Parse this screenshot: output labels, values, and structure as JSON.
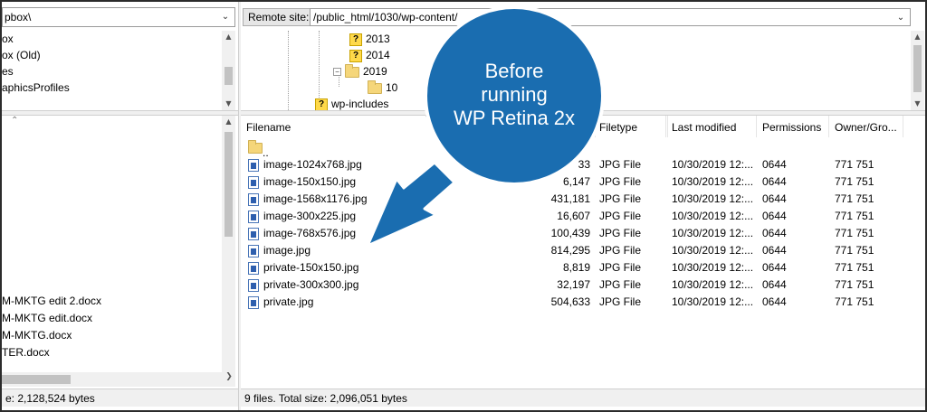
{
  "local": {
    "path": "pbox\\",
    "tree": [
      "ox",
      "ox (Old)",
      "es",
      "aphicsProfiles"
    ],
    "files": [
      "M-MKTG edit 2.docx",
      "M-MKTG edit.docx",
      "M-MKTG.docx",
      "TER.docx"
    ],
    "status": "e: 2,128,524 bytes"
  },
  "remote": {
    "label": "Remote site:",
    "path": "/public_html/1030/wp-content/",
    "tree": [
      {
        "label": "2013",
        "icon": "question-folder-icon"
      },
      {
        "label": "2014",
        "icon": "question-folder-icon"
      },
      {
        "label": "2019",
        "icon": "folder-icon"
      },
      {
        "label": "10",
        "icon": "folder-icon"
      },
      {
        "label": "wp-includes",
        "icon": "question-folder-icon"
      }
    ],
    "columns": {
      "filename": "Filename",
      "filetype": "Filetype",
      "modified": "Last modified",
      "permissions": "Permissions",
      "owner": "Owner/Gro..."
    },
    "parent": "..",
    "files": [
      {
        "name": "image-1024x768.jpg",
        "size": "33",
        "type": "JPG File",
        "modified": "10/30/2019 12:...",
        "perm": "0644",
        "owner": "771 751"
      },
      {
        "name": "image-150x150.jpg",
        "size": "6,147",
        "type": "JPG File",
        "modified": "10/30/2019 12:...",
        "perm": "0644",
        "owner": "771 751"
      },
      {
        "name": "image-1568x1176.jpg",
        "size": "431,181",
        "type": "JPG File",
        "modified": "10/30/2019 12:...",
        "perm": "0644",
        "owner": "771 751"
      },
      {
        "name": "image-300x225.jpg",
        "size": "16,607",
        "type": "JPG File",
        "modified": "10/30/2019 12:...",
        "perm": "0644",
        "owner": "771 751"
      },
      {
        "name": "image-768x576.jpg",
        "size": "100,439",
        "type": "JPG File",
        "modified": "10/30/2019 12:...",
        "perm": "0644",
        "owner": "771 751"
      },
      {
        "name": "image.jpg",
        "size": "814,295",
        "type": "JPG File",
        "modified": "10/30/2019 12:...",
        "perm": "0644",
        "owner": "771 751"
      },
      {
        "name": "private-150x150.jpg",
        "size": "8,819",
        "type": "JPG File",
        "modified": "10/30/2019 12:...",
        "perm": "0644",
        "owner": "771 751"
      },
      {
        "name": "private-300x300.jpg",
        "size": "32,197",
        "type": "JPG File",
        "modified": "10/30/2019 12:...",
        "perm": "0644",
        "owner": "771 751"
      },
      {
        "name": "private.jpg",
        "size": "504,633",
        "type": "JPG File",
        "modified": "10/30/2019 12:...",
        "perm": "0644",
        "owner": "771 751"
      }
    ],
    "status": "9 files. Total size: 2,096,051 bytes"
  },
  "callout": {
    "lines": [
      "Before",
      "running",
      "WP Retina 2x"
    ],
    "color": "#1a6db0"
  }
}
